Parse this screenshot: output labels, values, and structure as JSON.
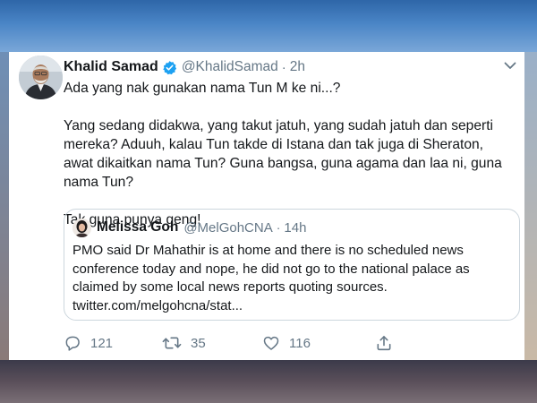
{
  "tweet": {
    "author_name": "Khalid Samad",
    "handle": "@KhalidSamad",
    "separator": "·",
    "time": "2h",
    "paragraphs": [
      "Ada yang nak gunakan nama Tun M ke ni...?",
      "Yang sedang didakwa, yang takut jatuh, yang sudah jatuh dan seperti mereka? Aduuh, kalau Tun takde di Istana dan tak juga di Sheraton, awat dikaitkan nama Tun? Guna bangsa, guna agama dan laa ni, guna  nama Tun?",
      "Tak guna punya geng!"
    ],
    "verified_icon": "verified-badge-icon",
    "menu_icon": "chevron-down-icon"
  },
  "quoted_tweet": {
    "author_name": "Melissa Goh",
    "handle": "@MelGohCNA",
    "separator": "·",
    "time": "14h",
    "text": "PMO said Dr Mahathir is at home and there is no scheduled news conference today and nope, he did not go to the national palace as claimed by some local news reports quoting sources. twitter.com/melgohcna/stat..."
  },
  "actions": {
    "replies": "121",
    "retweets": "35",
    "likes": "116",
    "icons": [
      "reply-icon",
      "retweet-icon",
      "like-icon",
      "share-icon"
    ]
  },
  "colors": {
    "text_primary": "#14171a",
    "text_secondary": "#657786",
    "verified_blue": "#1da1f2",
    "border": "#ccd6dd"
  }
}
